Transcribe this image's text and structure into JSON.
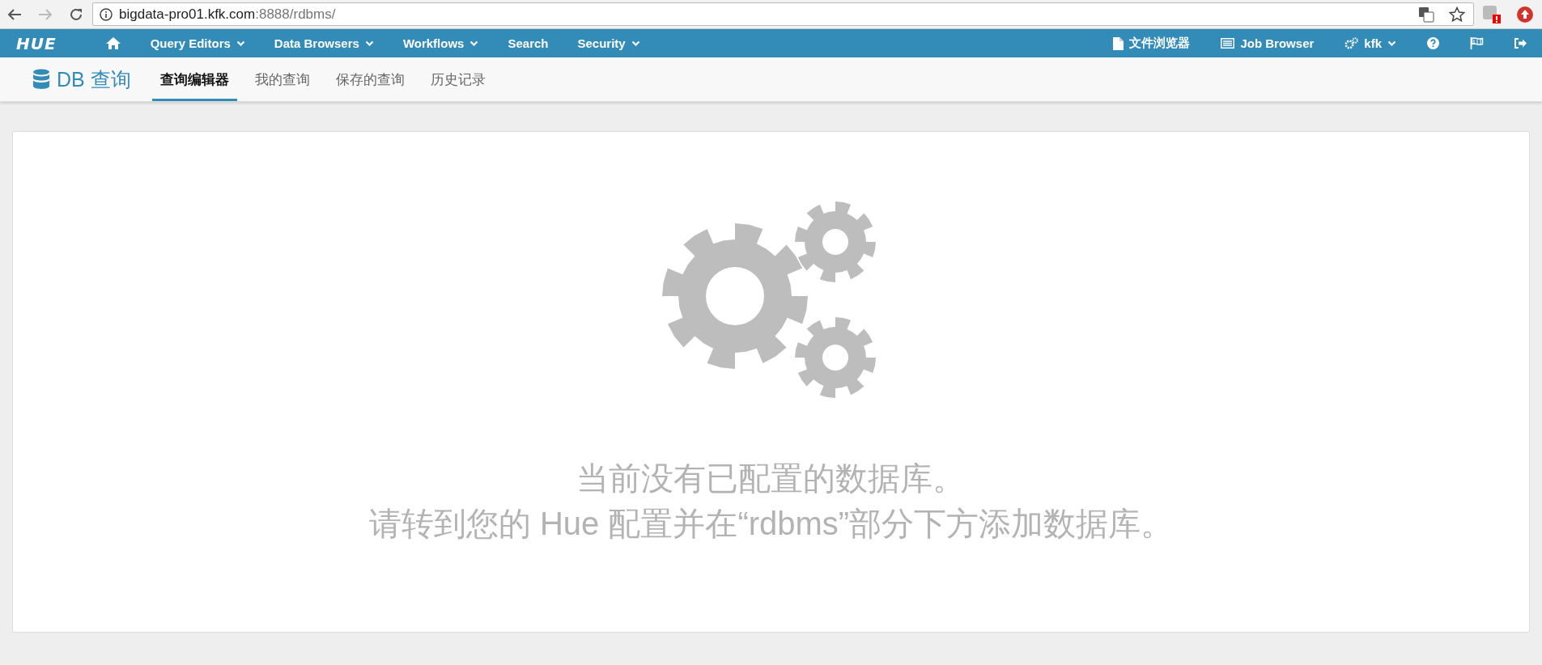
{
  "browser": {
    "address": {
      "host": "bigdata-pro01.kfk.com",
      "path": ":8888/rdbms/"
    }
  },
  "navbar": {
    "logo": "HUE",
    "left_items": [
      {
        "kind": "home"
      },
      {
        "kind": "dropdown",
        "label": "Query Editors"
      },
      {
        "kind": "dropdown",
        "label": "Data Browsers"
      },
      {
        "kind": "dropdown",
        "label": "Workflows"
      },
      {
        "kind": "link",
        "label": "Search"
      },
      {
        "kind": "dropdown",
        "label": "Security"
      }
    ],
    "right_items": [
      {
        "kind": "file",
        "label": "文件浏览器"
      },
      {
        "kind": "list",
        "label": "Job Browser"
      },
      {
        "kind": "user",
        "label": "kfk"
      },
      {
        "kind": "help"
      },
      {
        "kind": "flag"
      },
      {
        "kind": "logout"
      }
    ]
  },
  "subnav": {
    "app_title": "DB 查询",
    "tabs": [
      {
        "label": "查询编辑器",
        "selected": true
      },
      {
        "label": "我的查询",
        "selected": false
      },
      {
        "label": "保存的查询",
        "selected": false
      },
      {
        "label": "历史记录",
        "selected": false
      }
    ]
  },
  "empty_state": {
    "lines": [
      "当前没有已配置的数据库。",
      "请转到您的 Hue 配置并在“rdbms”部分下方添加数据库。"
    ]
  }
}
